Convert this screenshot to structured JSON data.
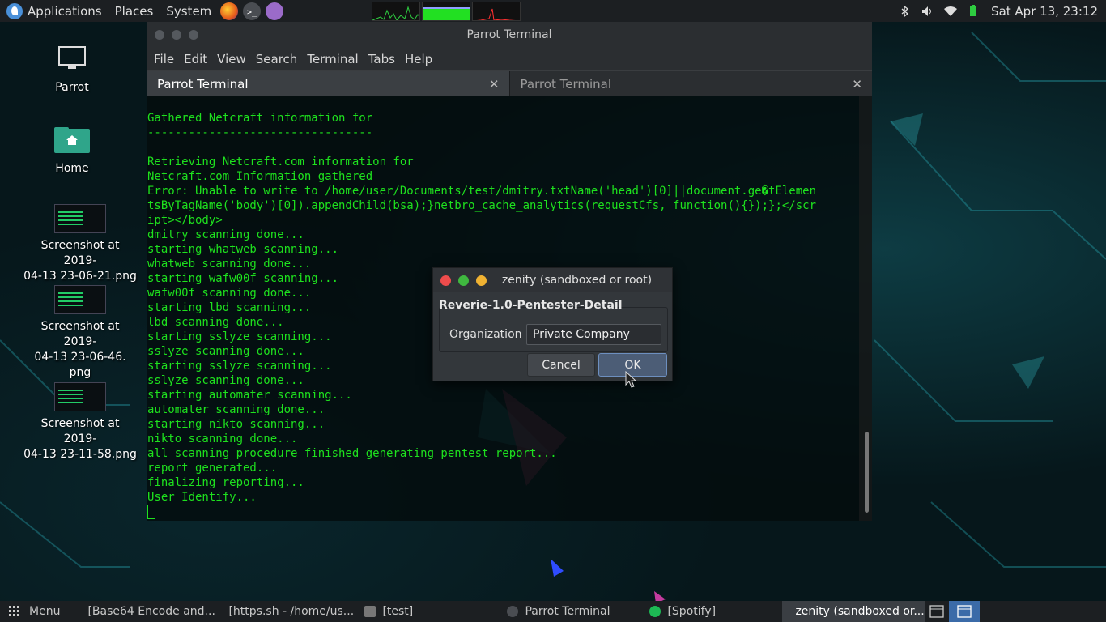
{
  "top_panel": {
    "applications_label": "Applications",
    "places_label": "Places",
    "system_label": "System",
    "datetime": "Sat Apr 13, 23:12"
  },
  "desktop": {
    "icons": [
      {
        "label": "Parrot"
      },
      {
        "label": "Home"
      },
      {
        "label_line1": "Screenshot at 2019-",
        "label_line2": "04-13 23-06-21.png"
      },
      {
        "label_line1": "Screenshot at 2019-",
        "label_line2": "04-13 23-06-46.",
        "label_line3": "png"
      },
      {
        "label_line1": "Screenshot at 2019-",
        "label_line2": "04-13 23-11-58.png"
      }
    ]
  },
  "terminal": {
    "title": "Parrot Terminal",
    "menu": [
      "File",
      "Edit",
      "View",
      "Search",
      "Terminal",
      "Tabs",
      "Help"
    ],
    "tabs": [
      {
        "label": "Parrot Terminal",
        "close": "✕"
      },
      {
        "label": "Parrot Terminal",
        "close": "✕"
      }
    ],
    "lines": [
      "Gathered Netcraft information for",
      "---------------------------------",
      "",
      "Retrieving Netcraft.com information for",
      "Netcraft.com Information gathered",
      "Error: Unable to write to /home/user/Documents/test/dmitry.txtName('head')[0]||document.ge�tElemen",
      "tsByTagName('body')[0]).appendChild(bsa);}netbro_cache_analytics(requestCfs, function(){});};</scr",
      "ipt></body>",
      "dmitry scanning done...",
      "starting whatweb scanning...",
      "whatweb scanning done...",
      "starting wafw00f scanning...",
      "wafw00f scanning done...",
      "starting lbd scanning...",
      "lbd scanning done...",
      "starting sslyze scanning...",
      "sslyze scanning done...",
      "starting sslyze scanning...",
      "sslyze scanning done...",
      "starting automater scanning...",
      "automater scanning done...",
      "starting nikto scanning...",
      "nikto scanning done...",
      "all scanning procedure finished generating pentest report...",
      "report generated...",
      "finalizing reporting...",
      "User Identify..."
    ]
  },
  "dialog": {
    "title": "zenity (sandboxed or root)",
    "heading": "Reverie-1.0-Pentester-Detail",
    "field_label": "Organization",
    "field_value": "Private Company",
    "cancel_label": "Cancel",
    "ok_label": "OK"
  },
  "taskbar": {
    "menu_label": "Menu",
    "tasks": [
      {
        "label": "[Base64 Encode and...",
        "icon": "firefox-icon"
      },
      {
        "label": "[https.sh - /home/us...",
        "icon": "editor-icon"
      },
      {
        "label": "[test]",
        "icon": "folder-icon"
      },
      {
        "label": "Parrot Terminal",
        "icon": "terminal-icon"
      },
      {
        "label": "[Spotify]",
        "icon": "spotify-icon"
      },
      {
        "label": "zenity (sandboxed or...",
        "icon": "window-icon"
      }
    ]
  },
  "colors": {
    "terminal_text": "#1ee11e",
    "panel_bg": "#1c1f22",
    "ok_button": "#4c5d76"
  }
}
